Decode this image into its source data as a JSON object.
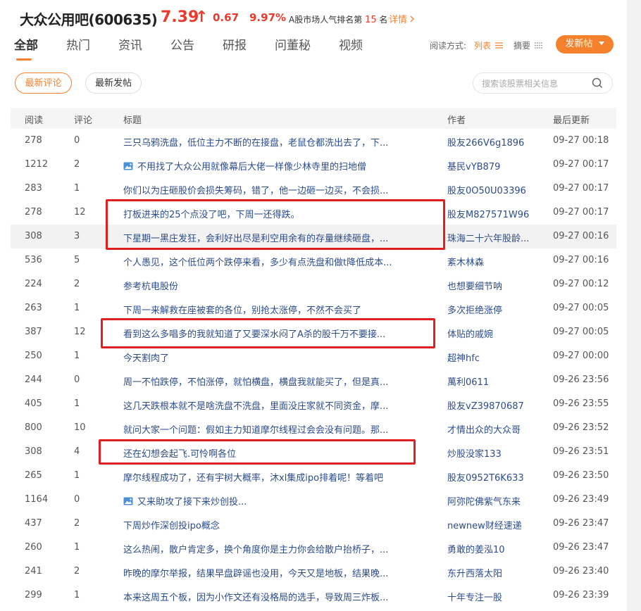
{
  "header": {
    "stock_name": "大众公用吧(600635)",
    "price": "7.39",
    "arrow": "↑",
    "change": "0.67",
    "change_pct": "9.97%",
    "rank_prefix": "A股市场人气排名第",
    "rank_num": "15",
    "rank_suffix": "名",
    "detail": "详情"
  },
  "tabs": [
    {
      "label": "全部",
      "active": true
    },
    {
      "label": "热门"
    },
    {
      "label": "资讯"
    },
    {
      "label": "公告"
    },
    {
      "label": "研报"
    },
    {
      "label": "问董秘"
    },
    {
      "label": "视频"
    }
  ],
  "read_mode": {
    "label": "阅读方式:",
    "list": "列表",
    "summary": "摘要"
  },
  "post_button": "发新帖",
  "filters": {
    "latest_comment": "最新评论",
    "latest_post": "最新发帖"
  },
  "search": {
    "placeholder": "搜索该股票相关信息"
  },
  "table": {
    "headers": {
      "read": "阅读",
      "comment": "评论",
      "title": "标题",
      "author": "作者",
      "updated": "最后更新"
    },
    "rows": [
      {
        "read": "278",
        "comment": "0",
        "title": "三只乌鸦洗盘，低位主力不断的在接盘，老鼠仓都洗出去了，下...",
        "author": "股友266V6g1896",
        "time": "09-27 00:18"
      },
      {
        "read": "1212",
        "comment": "2",
        "title": "不用找了大众公用就像幕后大佬一样像少林寺里的扫地僧",
        "author": "基民vYB879",
        "time": "09-27 00:17",
        "has_image": true
      },
      {
        "read": "283",
        "comment": "1",
        "title": "你们以为庄砸股价会损失筹码，错了，他一边砸一边买，不会损...",
        "author": "股友0O50U03396",
        "time": "09-27 00:17"
      },
      {
        "read": "278",
        "comment": "12",
        "title": "打板进来的25个点没了吧，下周一还得跌。",
        "author": "股友M827571W96",
        "time": "09-27 00:17"
      },
      {
        "read": "308",
        "comment": "3",
        "title": "下星期一黑庄发狂，会利好出尽是利空用余有的存量继续砸盘，...",
        "author": "珠海二十六年股龄...",
        "time": "09-27 00:16",
        "highlight": true
      },
      {
        "read": "536",
        "comment": "5",
        "title": "个人愚见，这个低位两个跌停来看，多少有点洗盘和做t降低成本...",
        "author": "紊木林森",
        "time": "09-27 00:16"
      },
      {
        "read": "224",
        "comment": "2",
        "title": "参考杭电股份",
        "author": "也想要细节呐",
        "time": "09-27 00:12"
      },
      {
        "read": "263",
        "comment": "1",
        "title": "下周一来解救在座被套的各位，别抢太涨停，不然不会买了",
        "author": "多次拒绝涨停",
        "time": "09-27 00:05"
      },
      {
        "read": "387",
        "comment": "12",
        "title": "看到这么多唱多的我就知道了又要深水闷了A杀的股千万不要接...",
        "author": "体贴的戚婉",
        "time": "09-27 00:05"
      },
      {
        "read": "250",
        "comment": "1",
        "title": "今天割肉了",
        "author": "超神hfc",
        "time": "09-27 00:00"
      },
      {
        "read": "244",
        "comment": "0",
        "title": "周一不怕跌停，不怕涨停，就怕横盘，横盘我就能买了，但是真...",
        "author": "萬利0611",
        "time": "09-26 23:56"
      },
      {
        "read": "405",
        "comment": "1",
        "title": "这几天跌根本就不是啥洗盘不洗盘，里面没庄家就不同资金，摩...",
        "author": "股友vZ39870687",
        "time": "09-26 23:55"
      },
      {
        "read": "800",
        "comment": "10",
        "title": "就问大家一个问题：假如主力知道摩尔线程过会会没有问题。那...",
        "author": "才情出众的大众哥",
        "time": "09-26 23:52"
      },
      {
        "read": "308",
        "comment": "4",
        "title": "还在幻想会起飞.可怜啊各位",
        "author": "炒股没家133",
        "time": "09-26 23:51"
      },
      {
        "read": "265",
        "comment": "1",
        "title": "摩尔线程成功了，还有宇树大概率，沐xl集成ipo排着呢！等着吧",
        "author": "股友0952T6K633",
        "time": "09-26 23:50"
      },
      {
        "read": "1164",
        "comment": "0",
        "title": "又来助攻了接下来炒创投...",
        "author": "阿弥陀佛紫气东来",
        "time": "09-26 23:49",
        "has_image": true
      },
      {
        "read": "437",
        "comment": "2",
        "title": "下周炒作深创投ipo概念",
        "author": "newnew财经速递",
        "time": "09-26 23:47"
      },
      {
        "read": "260",
        "comment": "1",
        "title": "这么热闹，散户肯定多，换个角度你是主力你会给散户抬桥子，...",
        "author": "勇敢的姜泓10",
        "time": "09-26 23:47"
      },
      {
        "read": "241",
        "comment": "2",
        "title": "昨晚的摩尔举报，结果早盘辟谣也没用，今天又是地板，结果晚...",
        "author": "东升西落太阳",
        "time": "09-26 23:40"
      },
      {
        "read": "299",
        "comment": "1",
        "title": "本来这周五个板，因为小作文还有没格局的选手，导致周三炸板...",
        "author": "十年专注一股",
        "time": "09-26 23:39"
      }
    ]
  },
  "colors": {
    "accent": "#f5812c",
    "up_red": "#e83b2e",
    "link_blue": "#2b4c8c",
    "annotation_red": "#e02020"
  }
}
